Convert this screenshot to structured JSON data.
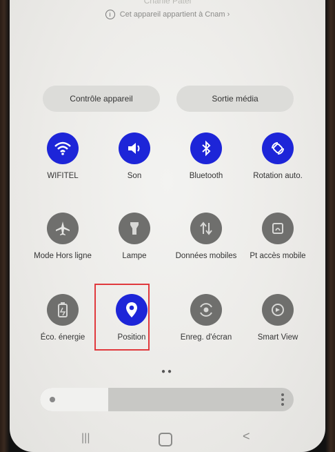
{
  "header": {
    "name": "Charlie Patel",
    "owner_text": "Cet appareil appartient à Cnam",
    "owner_icon": "info-icon"
  },
  "pills": {
    "device_control": "Contrôle appareil",
    "media_output": "Sortie média"
  },
  "tiles": [
    {
      "label": "WIFITEL",
      "icon": "wifi-icon",
      "active": true
    },
    {
      "label": "Son",
      "icon": "speaker-icon",
      "active": true
    },
    {
      "label": "Bluetooth",
      "icon": "bluetooth-icon",
      "active": true
    },
    {
      "label": "Rotation auto.",
      "icon": "rotate-icon",
      "active": true
    },
    {
      "label": "Mode Hors ligne",
      "icon": "airplane-icon",
      "active": false
    },
    {
      "label": "Lampe",
      "icon": "flashlight-icon",
      "active": false
    },
    {
      "label": "Données mobiles",
      "icon": "mobile-data-icon",
      "active": false
    },
    {
      "label": "Pt accès mobile",
      "icon": "hotspot-icon",
      "active": false
    },
    {
      "label": "Éco. énergie",
      "icon": "battery-saver-icon",
      "active": false
    },
    {
      "label": "Position",
      "icon": "location-pin-icon",
      "active": true
    },
    {
      "label": "Enreg. d'écran",
      "icon": "screen-record-icon",
      "active": false
    },
    {
      "label": "Smart View",
      "icon": "smart-view-icon",
      "active": false
    }
  ],
  "brightness": {
    "level": 0.27
  },
  "colors": {
    "active": "#1d25d8",
    "inactive": "#6f6f6d",
    "highlight": "#e0383c"
  }
}
